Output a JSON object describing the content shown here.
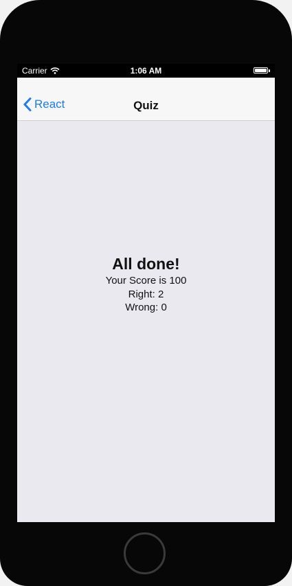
{
  "status_bar": {
    "carrier": "Carrier",
    "time": "1:06 AM",
    "icons": [
      "wifi-icon",
      "battery-icon"
    ]
  },
  "nav": {
    "back_label": "React",
    "title": "Quiz",
    "icons": [
      "chevron-left-icon"
    ],
    "accent_color": "#1a7cf4"
  },
  "result": {
    "title": "All done!",
    "score_line": "Your Score is 100",
    "right_line": "Right: 2",
    "wrong_line": "Wrong: 0"
  },
  "colors": {
    "screen_background": "#e9e9ef",
    "nav_background": "#f7f7f7",
    "device_frame": "#070707"
  }
}
